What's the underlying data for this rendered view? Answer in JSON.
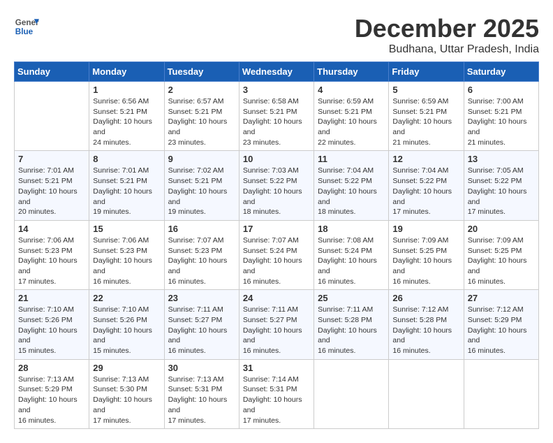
{
  "logo": {
    "general": "General",
    "blue": "Blue"
  },
  "title": "December 2025",
  "location": "Budhana, Uttar Pradesh, India",
  "days_of_week": [
    "Sunday",
    "Monday",
    "Tuesday",
    "Wednesday",
    "Thursday",
    "Friday",
    "Saturday"
  ],
  "weeks": [
    [
      {
        "day": "",
        "sunrise": "",
        "sunset": "",
        "daylight": ""
      },
      {
        "day": "1",
        "sunrise": "Sunrise: 6:56 AM",
        "sunset": "Sunset: 5:21 PM",
        "daylight": "Daylight: 10 hours and 24 minutes."
      },
      {
        "day": "2",
        "sunrise": "Sunrise: 6:57 AM",
        "sunset": "Sunset: 5:21 PM",
        "daylight": "Daylight: 10 hours and 23 minutes."
      },
      {
        "day": "3",
        "sunrise": "Sunrise: 6:58 AM",
        "sunset": "Sunset: 5:21 PM",
        "daylight": "Daylight: 10 hours and 23 minutes."
      },
      {
        "day": "4",
        "sunrise": "Sunrise: 6:59 AM",
        "sunset": "Sunset: 5:21 PM",
        "daylight": "Daylight: 10 hours and 22 minutes."
      },
      {
        "day": "5",
        "sunrise": "Sunrise: 6:59 AM",
        "sunset": "Sunset: 5:21 PM",
        "daylight": "Daylight: 10 hours and 21 minutes."
      },
      {
        "day": "6",
        "sunrise": "Sunrise: 7:00 AM",
        "sunset": "Sunset: 5:21 PM",
        "daylight": "Daylight: 10 hours and 21 minutes."
      }
    ],
    [
      {
        "day": "7",
        "sunrise": "Sunrise: 7:01 AM",
        "sunset": "Sunset: 5:21 PM",
        "daylight": "Daylight: 10 hours and 20 minutes."
      },
      {
        "day": "8",
        "sunrise": "Sunrise: 7:01 AM",
        "sunset": "Sunset: 5:21 PM",
        "daylight": "Daylight: 10 hours and 19 minutes."
      },
      {
        "day": "9",
        "sunrise": "Sunrise: 7:02 AM",
        "sunset": "Sunset: 5:21 PM",
        "daylight": "Daylight: 10 hours and 19 minutes."
      },
      {
        "day": "10",
        "sunrise": "Sunrise: 7:03 AM",
        "sunset": "Sunset: 5:22 PM",
        "daylight": "Daylight: 10 hours and 18 minutes."
      },
      {
        "day": "11",
        "sunrise": "Sunrise: 7:04 AM",
        "sunset": "Sunset: 5:22 PM",
        "daylight": "Daylight: 10 hours and 18 minutes."
      },
      {
        "day": "12",
        "sunrise": "Sunrise: 7:04 AM",
        "sunset": "Sunset: 5:22 PM",
        "daylight": "Daylight: 10 hours and 17 minutes."
      },
      {
        "day": "13",
        "sunrise": "Sunrise: 7:05 AM",
        "sunset": "Sunset: 5:22 PM",
        "daylight": "Daylight: 10 hours and 17 minutes."
      }
    ],
    [
      {
        "day": "14",
        "sunrise": "Sunrise: 7:06 AM",
        "sunset": "Sunset: 5:23 PM",
        "daylight": "Daylight: 10 hours and 17 minutes."
      },
      {
        "day": "15",
        "sunrise": "Sunrise: 7:06 AM",
        "sunset": "Sunset: 5:23 PM",
        "daylight": "Daylight: 10 hours and 16 minutes."
      },
      {
        "day": "16",
        "sunrise": "Sunrise: 7:07 AM",
        "sunset": "Sunset: 5:23 PM",
        "daylight": "Daylight: 10 hours and 16 minutes."
      },
      {
        "day": "17",
        "sunrise": "Sunrise: 7:07 AM",
        "sunset": "Sunset: 5:24 PM",
        "daylight": "Daylight: 10 hours and 16 minutes."
      },
      {
        "day": "18",
        "sunrise": "Sunrise: 7:08 AM",
        "sunset": "Sunset: 5:24 PM",
        "daylight": "Daylight: 10 hours and 16 minutes."
      },
      {
        "day": "19",
        "sunrise": "Sunrise: 7:09 AM",
        "sunset": "Sunset: 5:25 PM",
        "daylight": "Daylight: 10 hours and 16 minutes."
      },
      {
        "day": "20",
        "sunrise": "Sunrise: 7:09 AM",
        "sunset": "Sunset: 5:25 PM",
        "daylight": "Daylight: 10 hours and 16 minutes."
      }
    ],
    [
      {
        "day": "21",
        "sunrise": "Sunrise: 7:10 AM",
        "sunset": "Sunset: 5:26 PM",
        "daylight": "Daylight: 10 hours and 15 minutes."
      },
      {
        "day": "22",
        "sunrise": "Sunrise: 7:10 AM",
        "sunset": "Sunset: 5:26 PM",
        "daylight": "Daylight: 10 hours and 15 minutes."
      },
      {
        "day": "23",
        "sunrise": "Sunrise: 7:11 AM",
        "sunset": "Sunset: 5:27 PM",
        "daylight": "Daylight: 10 hours and 16 minutes."
      },
      {
        "day": "24",
        "sunrise": "Sunrise: 7:11 AM",
        "sunset": "Sunset: 5:27 PM",
        "daylight": "Daylight: 10 hours and 16 minutes."
      },
      {
        "day": "25",
        "sunrise": "Sunrise: 7:11 AM",
        "sunset": "Sunset: 5:28 PM",
        "daylight": "Daylight: 10 hours and 16 minutes."
      },
      {
        "day": "26",
        "sunrise": "Sunrise: 7:12 AM",
        "sunset": "Sunset: 5:28 PM",
        "daylight": "Daylight: 10 hours and 16 minutes."
      },
      {
        "day": "27",
        "sunrise": "Sunrise: 7:12 AM",
        "sunset": "Sunset: 5:29 PM",
        "daylight": "Daylight: 10 hours and 16 minutes."
      }
    ],
    [
      {
        "day": "28",
        "sunrise": "Sunrise: 7:13 AM",
        "sunset": "Sunset: 5:29 PM",
        "daylight": "Daylight: 10 hours and 16 minutes."
      },
      {
        "day": "29",
        "sunrise": "Sunrise: 7:13 AM",
        "sunset": "Sunset: 5:30 PM",
        "daylight": "Daylight: 10 hours and 17 minutes."
      },
      {
        "day": "30",
        "sunrise": "Sunrise: 7:13 AM",
        "sunset": "Sunset: 5:31 PM",
        "daylight": "Daylight: 10 hours and 17 minutes."
      },
      {
        "day": "31",
        "sunrise": "Sunrise: 7:14 AM",
        "sunset": "Sunset: 5:31 PM",
        "daylight": "Daylight: 10 hours and 17 minutes."
      },
      {
        "day": "",
        "sunrise": "",
        "sunset": "",
        "daylight": ""
      },
      {
        "day": "",
        "sunrise": "",
        "sunset": "",
        "daylight": ""
      },
      {
        "day": "",
        "sunrise": "",
        "sunset": "",
        "daylight": ""
      }
    ]
  ]
}
